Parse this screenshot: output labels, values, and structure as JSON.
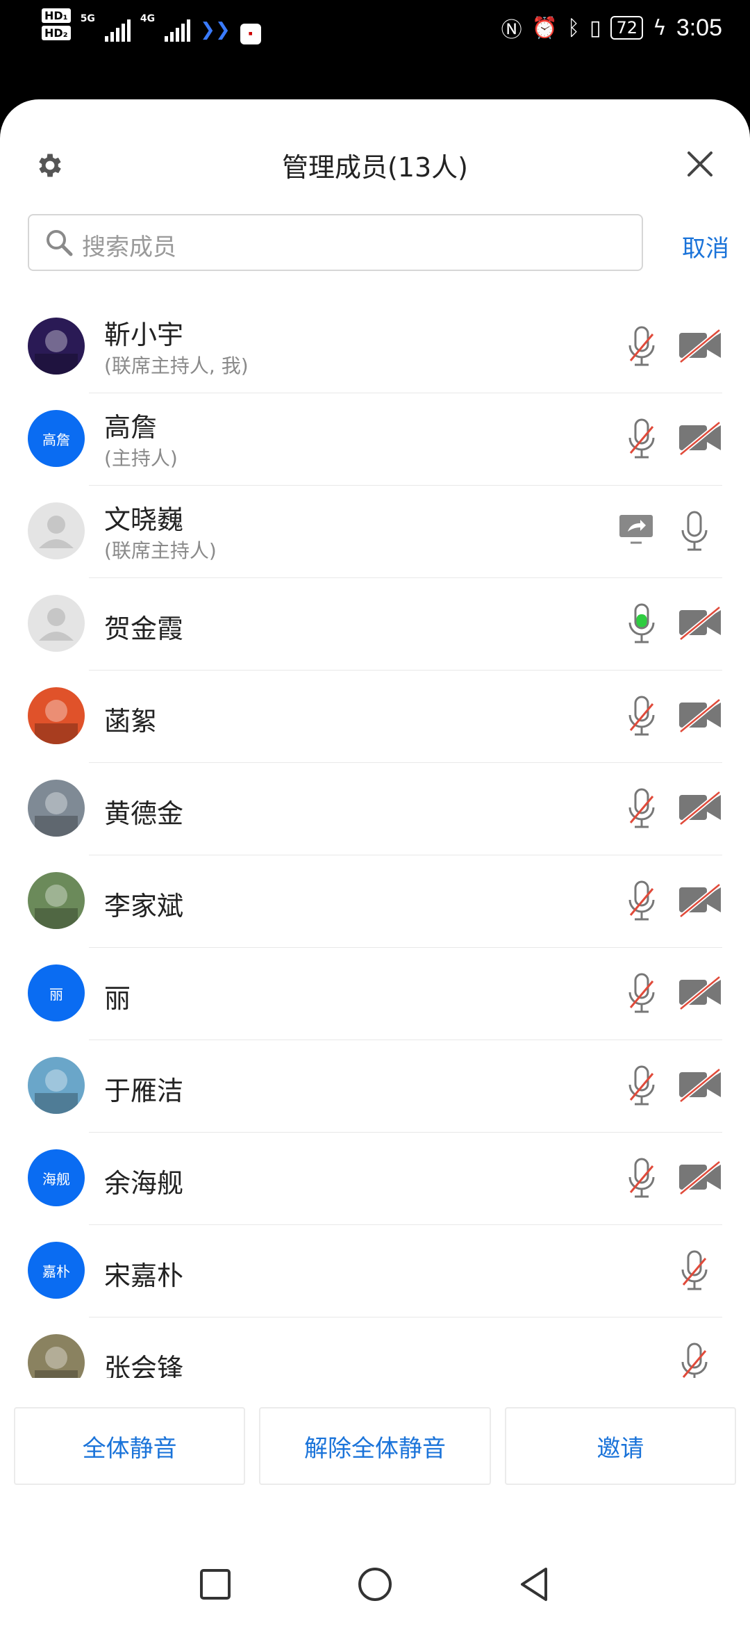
{
  "status_bar": {
    "hd1": "HD₁",
    "hd2": "HD₂",
    "net1": "5G",
    "net2": "4G",
    "battery": "72",
    "time": "3:05"
  },
  "header": {
    "title": "管理成员(13人)"
  },
  "search": {
    "placeholder": "搜索成员",
    "cancel_label": "取消"
  },
  "members": [
    {
      "name": "靳小宇",
      "role": "(联席主持人, 我)",
      "avatar_text": "",
      "avatar_color": "#2a1a55",
      "mic": "muted",
      "cam": "off"
    },
    {
      "name": "高詹",
      "role": "(主持人)",
      "avatar_text": "高詹",
      "avatar_color": "#0a6cf2",
      "mic": "muted",
      "cam": "off"
    },
    {
      "name": "文晓巍",
      "role": "(联席主持人)",
      "avatar_text": "",
      "avatar_color": "#e4e4e4",
      "mic": "on",
      "cam": "none",
      "sharing": true
    },
    {
      "name": "贺金霞",
      "role": "",
      "avatar_text": "",
      "avatar_color": "#e4e4e4",
      "mic": "speaking",
      "cam": "off"
    },
    {
      "name": "菡絮",
      "role": "",
      "avatar_text": "",
      "avatar_color": "#e0522a",
      "mic": "muted",
      "cam": "off"
    },
    {
      "name": "黄德金",
      "role": "",
      "avatar_text": "",
      "avatar_color": "#7f8a95",
      "mic": "muted",
      "cam": "off"
    },
    {
      "name": "李家斌",
      "role": "",
      "avatar_text": "",
      "avatar_color": "#6b8a5a",
      "mic": "muted",
      "cam": "off"
    },
    {
      "name": "丽",
      "role": "",
      "avatar_text": "丽",
      "avatar_color": "#0a6cf2",
      "mic": "muted",
      "cam": "off"
    },
    {
      "name": "于雁洁",
      "role": "",
      "avatar_text": "",
      "avatar_color": "#6aa6c9",
      "mic": "muted",
      "cam": "off"
    },
    {
      "name": "余海舰",
      "role": "",
      "avatar_text": "海舰",
      "avatar_color": "#0a6cf2",
      "mic": "muted",
      "cam": "off"
    },
    {
      "name": "宋嘉朴",
      "role": "",
      "avatar_text": "嘉朴",
      "avatar_color": "#0a6cf2",
      "mic": "muted",
      "cam": "none"
    },
    {
      "name": "张会锋",
      "role": "",
      "avatar_text": "",
      "avatar_color": "#8a8260",
      "mic": "muted",
      "cam": "none"
    }
  ],
  "actions": {
    "mute_all": "全体静音",
    "unmute_all": "解除全体静音",
    "invite": "邀请"
  },
  "colors": {
    "accent": "#1a73d9",
    "avatar_blue": "#0a6cf2",
    "muted_slash": "#e04a3a",
    "speaking": "#2ecc40"
  }
}
